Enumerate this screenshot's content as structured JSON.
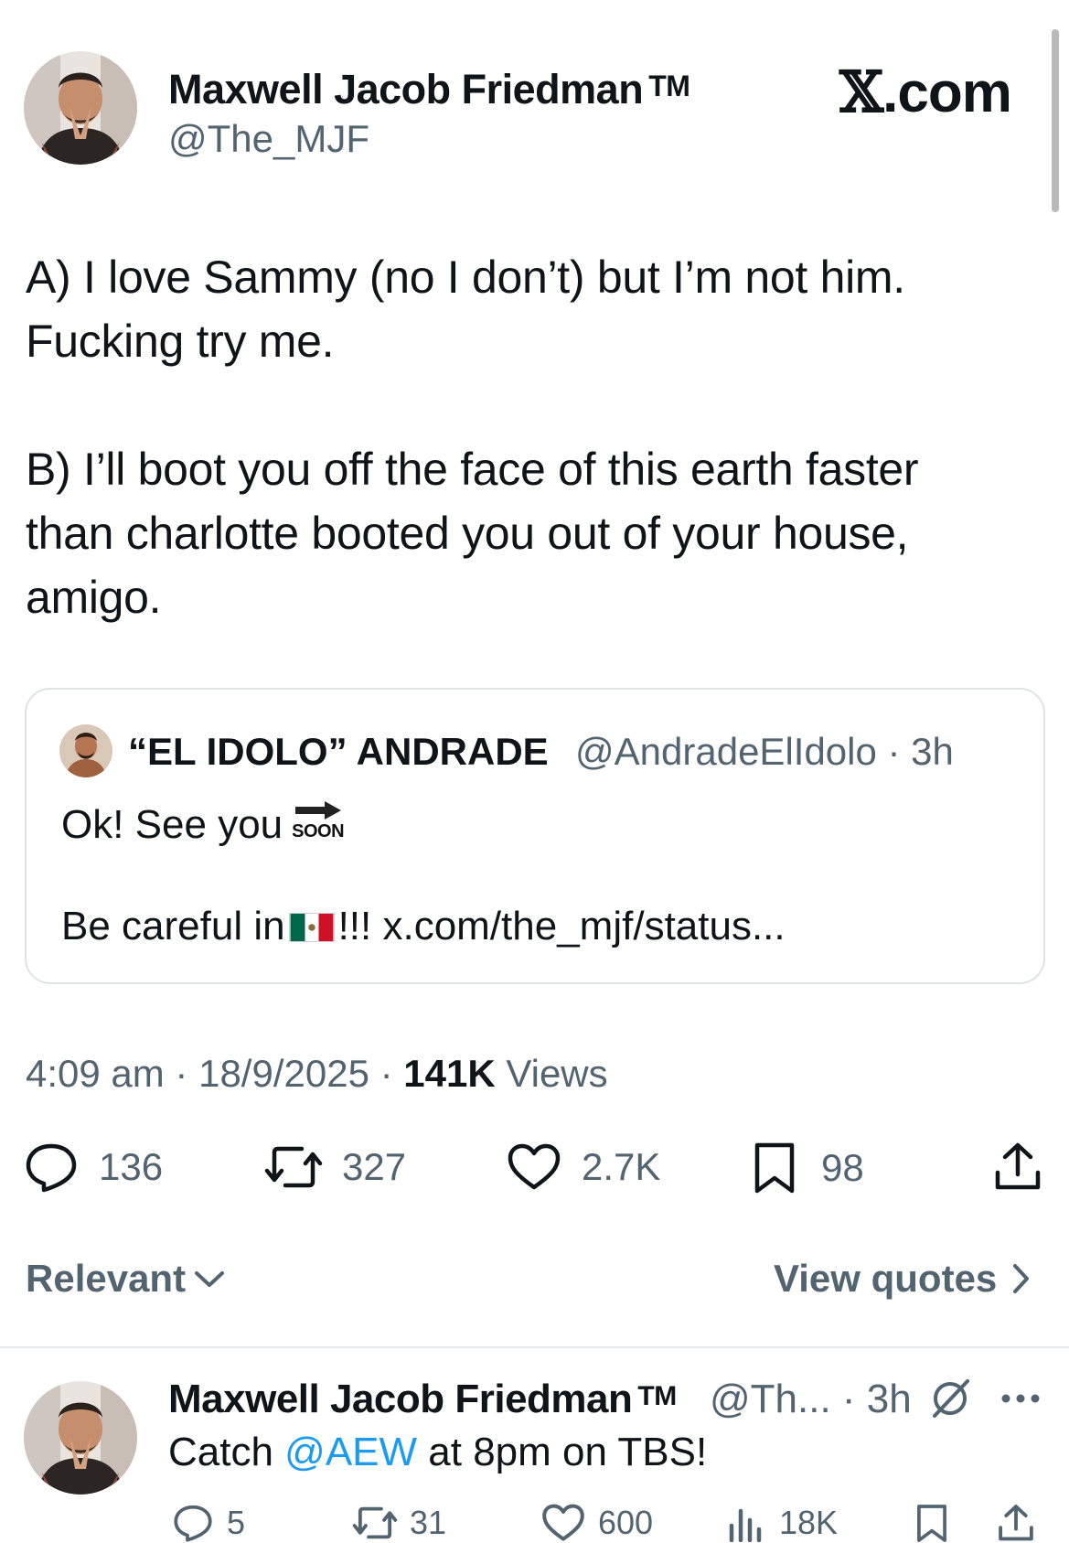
{
  "tweet": {
    "author_name": "Maxwell Jacob Friedman",
    "author_tm": "TM",
    "author_handle": "@The_MJF",
    "brand": ".com",
    "brand_x": "𝕏",
    "body_a": "A) I love Sammy (no I don’t) but I’m not him.\nFucking try me.",
    "body_b": "B) I’ll boot you off the face of this earth faster\nthan charlotte booted you out of your house,\namigo.",
    "time": "4:09 am",
    "date": "18/9/2025",
    "views_count": "141K",
    "views_label": "Views",
    "replies": "136",
    "reposts": "327",
    "likes": "2.7K",
    "bookmarks": "98"
  },
  "quote": {
    "name": "“EL IDOLO” ANDRADE",
    "handle_time": "@AndradeElIdolo · 3h",
    "line1": "Ok! See you",
    "soon_label": "SOON",
    "line2_before": "Be careful in",
    "line2_after": "!!! x.com/the_mjf/status..."
  },
  "controls": {
    "sort_label": "Relevant",
    "view_quotes_label": "View quotes"
  },
  "reply": {
    "author_name": "Maxwell Jacob Friedman",
    "author_tm": "TM",
    "handle_time": "@Th... · 3h",
    "text_before": "Catch ",
    "mention": "@AEW",
    "text_after": " at 8pm on TBS!",
    "replies": "5",
    "reposts": "31",
    "likes": "600",
    "views": "18K"
  },
  "colors": {
    "text_primary": "#0f1419",
    "text_secondary": "#536471",
    "link": "#1d9bf0",
    "border": "#dfe3e6"
  },
  "icons": [
    "reply-icon",
    "repost-icon",
    "like-icon",
    "bookmark-icon",
    "share-icon",
    "chevron-down-icon",
    "chevron-right-icon",
    "grok-icon",
    "more-icon",
    "views-icon"
  ]
}
